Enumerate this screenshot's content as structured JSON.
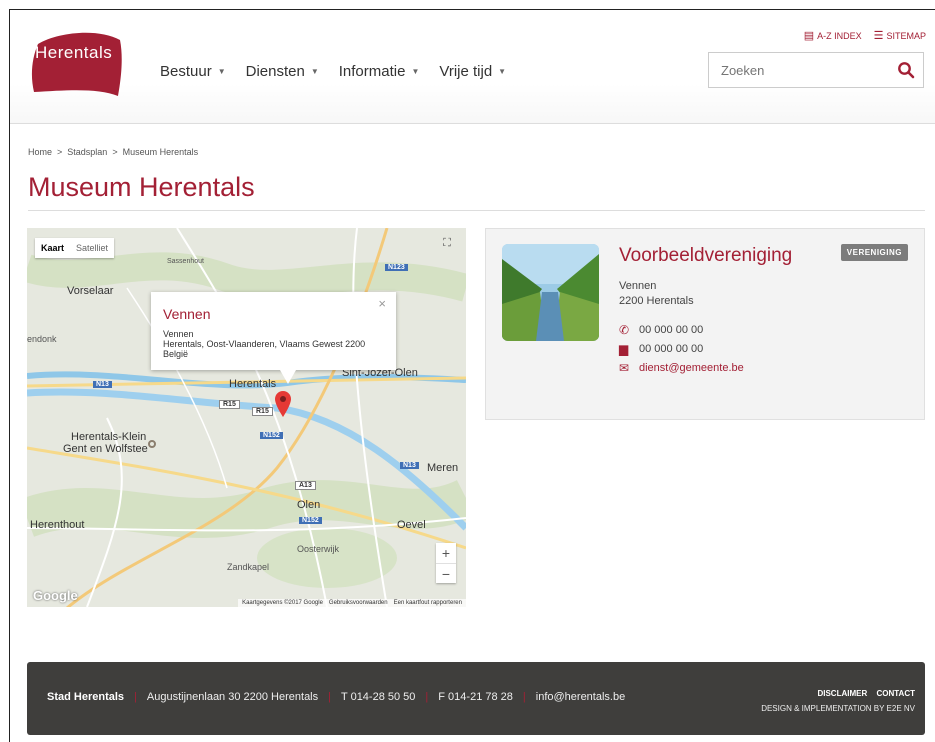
{
  "header": {
    "logo_text": "Herentals",
    "nav": [
      "Bestuur",
      "Diensten",
      "Informatie",
      "Vrije tijd"
    ],
    "az_index": "A-Z INDEX",
    "sitemap": "SITEMAP",
    "search_placeholder": "Zoeken"
  },
  "breadcrumb": [
    "Home",
    ">",
    "Stadsplan",
    ">",
    "Museum Herentals"
  ],
  "page_title": "Museum Herentals",
  "map": {
    "type_map": "Kaart",
    "type_satellite": "Satelliet",
    "popup": {
      "title": "Vennen",
      "line1": "Vennen",
      "line2": "Herentals, Oost-Vlaanderen, Vlaams Gewest 2200",
      "line3": "België"
    },
    "places": {
      "sassenhout": "Sassenhout",
      "vorselaar": "Vorselaar",
      "endonk": "endonk",
      "herentals": "Herentals",
      "herentals_klein": "Herentals-Klein",
      "gent_wolfstee": "Gent en Wolfstee",
      "sint_jozef": "Sint-Jozef-Olen",
      "meren": "Meren",
      "olen": "Olen",
      "oevel": "Oevel",
      "herenthout": "Herenthout",
      "oosterwijk": "Oosterwijk",
      "zandkapel": "Zandkapel"
    },
    "roads": {
      "n123": "N123",
      "n13": "N13",
      "r15a": "R15",
      "r15b": "R15",
      "n152": "N152",
      "n13b": "N13",
      "a13": "A13",
      "n152b": "N152"
    },
    "footer": [
      "Kaartgegevens ©2017 Google",
      "Gebruiksvoorwaarden",
      "Een kaartfout rapporteren"
    ],
    "google": "Google"
  },
  "card": {
    "name": "Voorbeeldvereniging",
    "badge": "VERENIGING",
    "street": "Vennen",
    "city": "2200 Herentals",
    "phone": "00 000 00 00",
    "fax": "00 000 00 00",
    "email": "dienst@gemeente.be"
  },
  "footer": {
    "name": "Stad Herentals",
    "address": "Augustijnenlaan 30 2200 Herentals",
    "phone": "T 014-28 50 50",
    "fax": "F 014-21 78 28",
    "email": "info@herentals.be",
    "disclaimer": "DISCLAIMER",
    "contact": "CONTACT",
    "credit": "DESIGN & IMPLEMENTATION BY E2E NV"
  },
  "colors": {
    "brand": "#a32035",
    "footer_bg": "#3f3e3c",
    "badge": "#7c7c7c"
  }
}
